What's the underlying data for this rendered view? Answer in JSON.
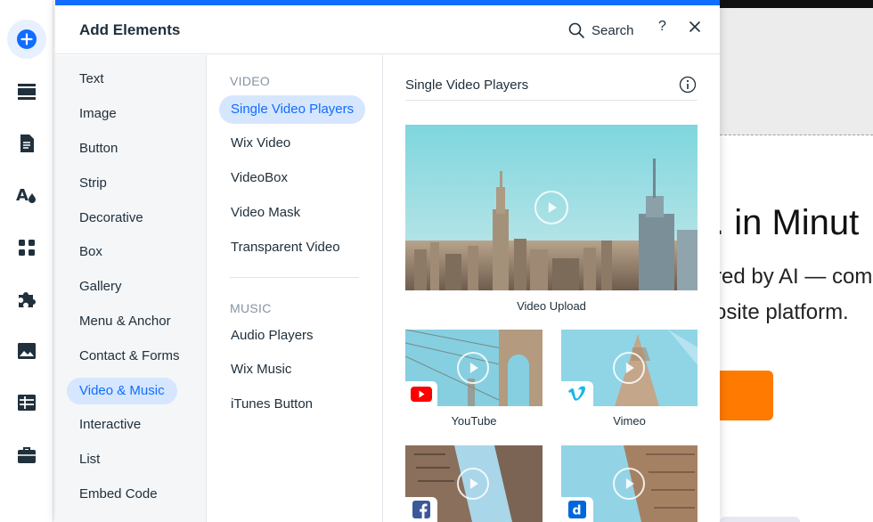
{
  "panel": {
    "title": "Add Elements",
    "search_label": "Search",
    "help_label": "?"
  },
  "rail": {
    "icons": [
      "add-icon",
      "strip-icon",
      "page-icon",
      "design-icon",
      "apps-icon",
      "puzzle-icon",
      "media-icon",
      "table-icon",
      "briefcase-icon"
    ]
  },
  "categories": [
    {
      "label": "Text"
    },
    {
      "label": "Image"
    },
    {
      "label": "Button"
    },
    {
      "label": "Strip"
    },
    {
      "label": "Decorative"
    },
    {
      "label": "Box"
    },
    {
      "label": "Gallery"
    },
    {
      "label": "Menu & Anchor"
    },
    {
      "label": "Contact & Forms"
    },
    {
      "label": "Video & Music",
      "active": true
    },
    {
      "label": "Interactive"
    },
    {
      "label": "List"
    },
    {
      "label": "Embed Code"
    }
  ],
  "subcategories": {
    "video_heading": "VIDEO",
    "video_items": [
      "Single Video Players",
      "Wix Video",
      "VideoBox",
      "Video Mask",
      "Transparent Video"
    ],
    "music_heading": "MUSIC",
    "music_items": [
      "Audio Players",
      "Wix Music",
      "iTunes Button"
    ],
    "active": "Single Video Players"
  },
  "content": {
    "section_title": "Single Video Players",
    "items": [
      {
        "label": "Video Upload"
      },
      {
        "label": "YouTube",
        "badge": "youtube-icon"
      },
      {
        "label": "Vimeo",
        "badge": "vimeo-icon"
      },
      {
        "label": "",
        "badge": "facebook-icon"
      },
      {
        "label": "",
        "badge": "dailymotion-icon"
      }
    ]
  },
  "site_preview": {
    "headline": ". in Minut",
    "line1": "red by AI — com",
    "line2": "osite platform."
  },
  "colors": {
    "accent": "#116dff",
    "active_bg": "#d6e6fe",
    "cta": "#ff7a00",
    "youtube": "#ff0000",
    "vimeo": "#1ab7ea",
    "facebook": "#3b5998",
    "dailymotion": "#0066dc"
  }
}
